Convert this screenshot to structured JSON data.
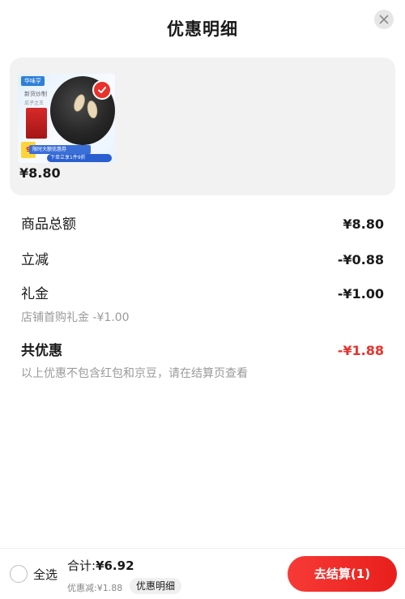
{
  "header": {
    "title": "优惠明细"
  },
  "product": {
    "price": "¥8.80",
    "brand_tag": "华味亨",
    "image_text_1": "新货炒制",
    "image_text_2": "瓜子之王",
    "promo_text_1": "限时大额优惠券",
    "promo_text_2": "下单立享1件9折",
    "tag_text": "9"
  },
  "breakdown": {
    "goods_total_label": "商品总额",
    "goods_total_value": "¥8.80",
    "instant_discount_label": "立减",
    "instant_discount_value": "-¥0.88",
    "gift_label": "礼金",
    "gift_value": "-¥1.00",
    "gift_note": "店铺首购礼金 -¥1.00",
    "total_discount_label": "共优惠",
    "total_discount_value": "-¥1.88",
    "disclaimer": "以上优惠不包含红包和京豆，请在结算页查看"
  },
  "bottom_bar": {
    "select_all": "全选",
    "total_label": "合计:",
    "total_amount": "¥6.92",
    "discount_text": "优惠减:¥1.88",
    "detail_button": "优惠明细",
    "checkout_button": "去结算(1)"
  },
  "colors": {
    "accent_red": "#e8322c",
    "card_bg": "#f2f2f2"
  }
}
